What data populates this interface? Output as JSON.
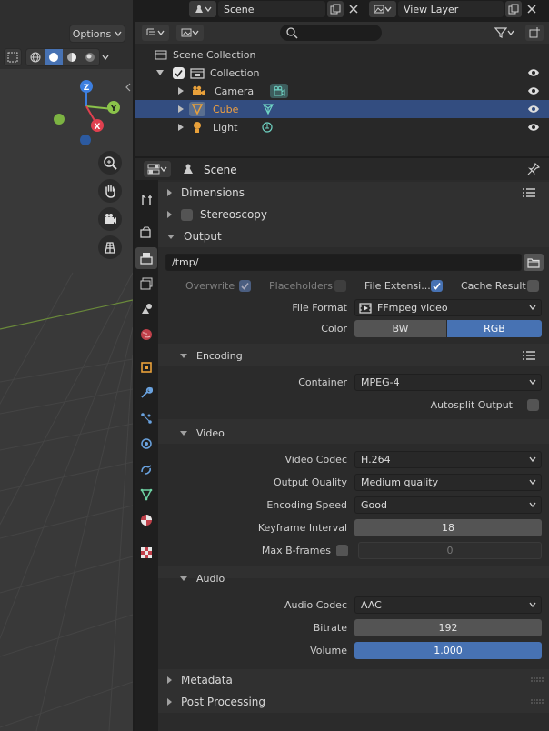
{
  "topbar": {
    "scene_label": "Scene",
    "view_layer_label": "View Layer"
  },
  "viewport": {
    "options_label": "Options",
    "gizmo": {
      "z": "Z",
      "y": "Y",
      "x": "X"
    }
  },
  "outliner": {
    "search_placeholder": "",
    "items": [
      {
        "label": "Scene Collection",
        "icon": "scene-collection-icon"
      },
      {
        "label": "Collection",
        "icon": "collection-icon"
      },
      {
        "label": "Camera",
        "icon": "camera-icon"
      },
      {
        "label": "Cube",
        "icon": "mesh-icon",
        "selected": true
      },
      {
        "label": "Light",
        "icon": "light-icon"
      }
    ]
  },
  "properties": {
    "context_label": "Scene",
    "panels": {
      "dimensions": "Dimensions",
      "stereoscopy": "Stereoscopy",
      "output": "Output",
      "metadata": "Metadata",
      "post_processing": "Post Processing"
    },
    "output": {
      "path": "/tmp/",
      "overwrite": "Overwrite",
      "placeholders": "Placeholders",
      "file_extensions": "File Extensi...",
      "cache_result": "Cache Result",
      "file_format_label": "File Format",
      "file_format_value": "FFmpeg video",
      "color_label": "Color",
      "color_bw": "BW",
      "color_rgb": "RGB"
    },
    "encoding": {
      "title": "Encoding",
      "container_label": "Container",
      "container_value": "MPEG-4",
      "autosplit_label": "Autosplit Output"
    },
    "video": {
      "title": "Video",
      "codec_label": "Video Codec",
      "codec_value": "H.264",
      "quality_label": "Output Quality",
      "quality_value": "Medium quality",
      "speed_label": "Encoding Speed",
      "speed_value": "Good",
      "keyframe_label": "Keyframe Interval",
      "keyframe_value": "18",
      "bframes_label": "Max B-frames",
      "bframes_value": "0"
    },
    "audio": {
      "title": "Audio",
      "codec_label": "Audio Codec",
      "codec_value": "AAC",
      "bitrate_label": "Bitrate",
      "bitrate_value": "192",
      "volume_label": "Volume",
      "volume_value": "1.000"
    }
  },
  "colors": {
    "accent_blue": "#4772b3",
    "selection_row": "#334d80",
    "cube_orange": "#e8a03a",
    "axis_x": "#e0404f",
    "axis_y": "#8bc34a",
    "axis_z": "#3d7fe0"
  }
}
